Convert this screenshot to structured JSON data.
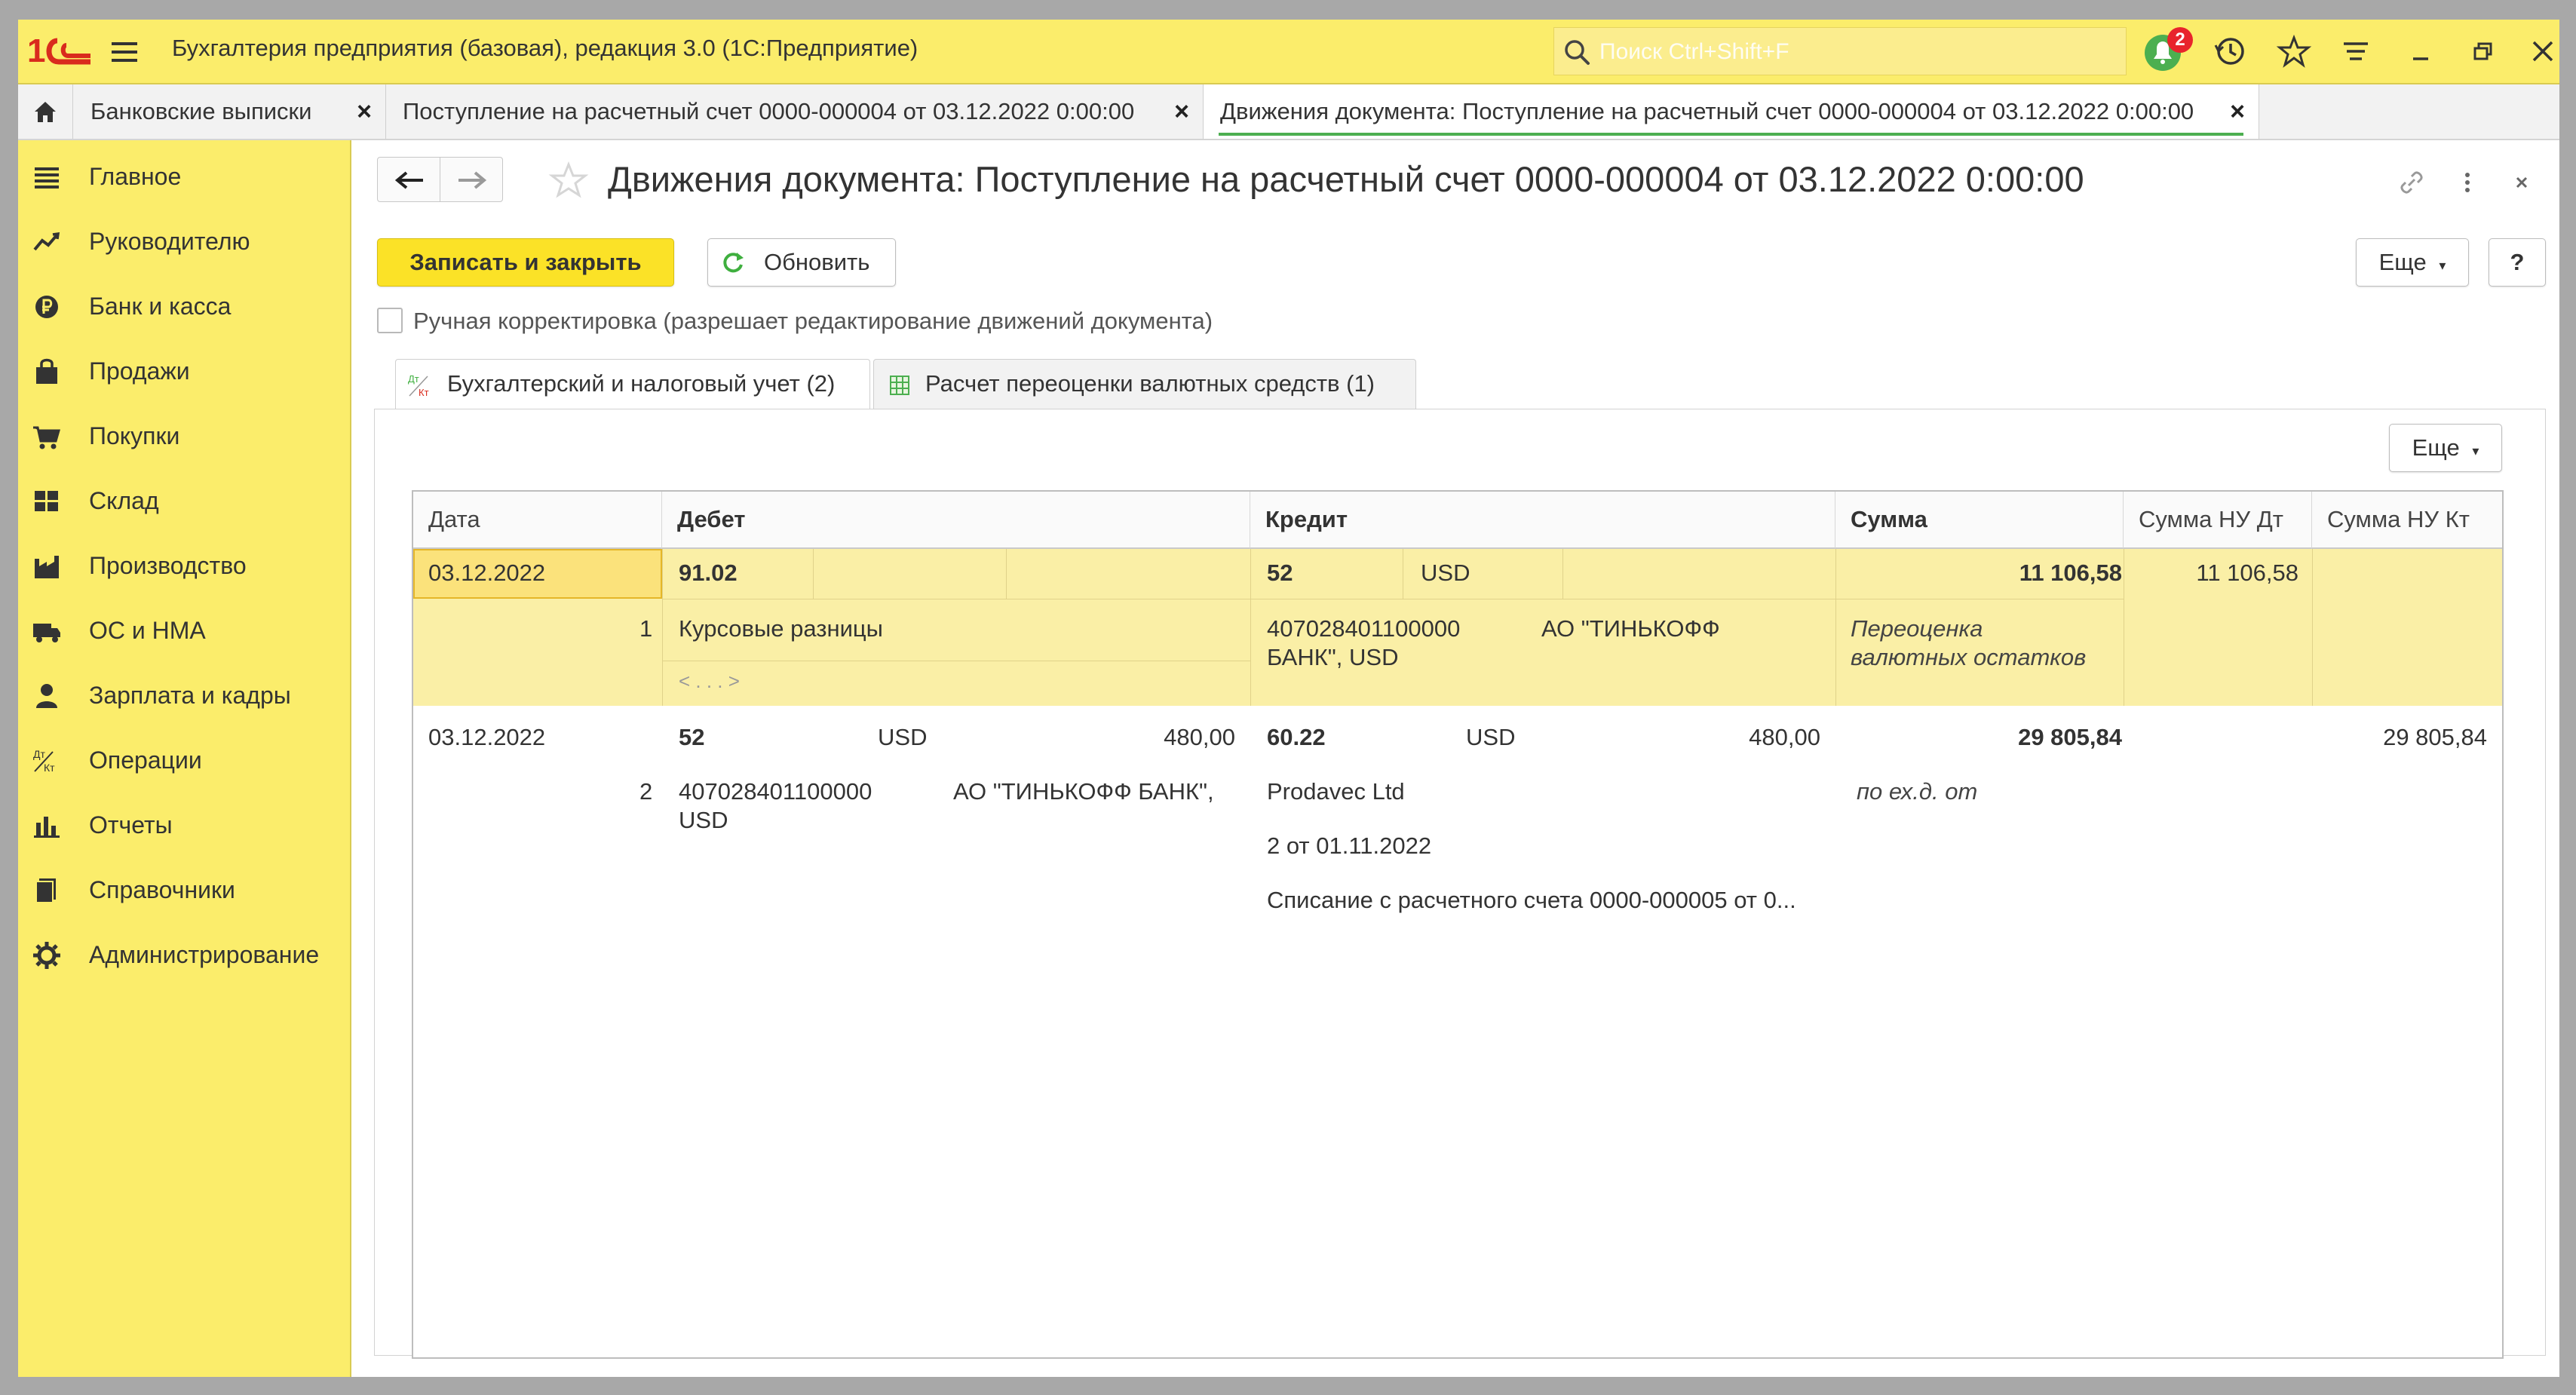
{
  "colors": {
    "accent_yellow": "#fbed6b",
    "save_button": "#fbe227",
    "selected_row": "#faefa6",
    "logo_red": "#d92b1d",
    "active_tab_underline": "#4caf50"
  },
  "app": {
    "title": "Бухгалтерия предприятия (базовая), редакция 3.0  (1С:Предприятие)"
  },
  "search": {
    "placeholder": "Поиск Ctrl+Shift+F"
  },
  "toolbar": {
    "notifications_count": "2"
  },
  "tabs": [
    {
      "label": "Банковские выписки",
      "close": "×"
    },
    {
      "label": "Поступление на расчетный счет 0000-000004 от 03.12.2022 0:00:00",
      "close": "×"
    },
    {
      "label": "Движения документа: Поступление на расчетный счет 0000-000004 от 03.12.2022 0:00:00",
      "close": "×"
    }
  ],
  "sidebar": {
    "items": [
      {
        "label": "Главное",
        "icon": "menu-icon"
      },
      {
        "label": "Руководителю",
        "icon": "trend-icon"
      },
      {
        "label": "Банк и касса",
        "icon": "ruble-coin-icon"
      },
      {
        "label": "Продажи",
        "icon": "shopping-bag-icon"
      },
      {
        "label": "Покупки",
        "icon": "cart-icon"
      },
      {
        "label": "Склад",
        "icon": "warehouse-icon"
      },
      {
        "label": "Производство",
        "icon": "factory-icon"
      },
      {
        "label": "ОС и НМА",
        "icon": "truck-icon"
      },
      {
        "label": "Зарплата и кадры",
        "icon": "person-icon"
      },
      {
        "label": "Операции",
        "icon": "dt-kt-icon"
      },
      {
        "label": "Отчеты",
        "icon": "bar-chart-icon"
      },
      {
        "label": "Справочники",
        "icon": "books-icon"
      },
      {
        "label": "Администрирование",
        "icon": "gear-icon"
      }
    ]
  },
  "form": {
    "title": "Движения документа: Поступление на расчетный счет 0000-000004 от 03.12.2022 0:00:00",
    "save_close_label": "Записать и закрыть",
    "refresh_label": "Обновить",
    "more_label": "Еще",
    "help_label": "?",
    "manual_correction_label": "Ручная корректировка (разрешает редактирование движений документа)",
    "inner_tabs": [
      {
        "label": "Бухгалтерский и налоговый учет (2)",
        "icon": "dt-kt-icon"
      },
      {
        "label": "Расчет переоценки валютных средств (1)",
        "icon": "table-icon"
      }
    ],
    "panel_more_label": "Еще"
  },
  "grid": {
    "columns": [
      "Дата",
      "Дебет",
      "Кредит",
      "Сумма",
      "Сумма НУ Дт",
      "Сумма НУ Кт"
    ],
    "rows": [
      {
        "date": "03.12.2022",
        "number": "1",
        "debit_account": "91.02",
        "debit_subconto": "Курсовые разницы",
        "debit_more": "< . . . >",
        "credit_account": "52",
        "credit_currency": "USD",
        "credit_subconto_1": "407028401100000",
        "credit_subconto_1b": "БАНК\", USD",
        "credit_subconto_2": "АО \"ТИНЬКОФФ",
        "amount": "11 106,58",
        "content_1": "Переоценка",
        "content_2": "валютных остатков",
        "amount_nu_dt": "11 106,58",
        "amount_nu_kt": ""
      },
      {
        "date": "03.12.2022",
        "number": "2",
        "debit_account": "52",
        "debit_currency": "USD",
        "debit_currency_amount": "480,00",
        "debit_subconto_1": "407028401100000",
        "debit_subconto_1b": "USD",
        "debit_subconto_2": "АО \"ТИНЬКОФФ БАНК\",",
        "credit_account": "60.22",
        "credit_currency": "USD",
        "credit_currency_amount": "480,00",
        "credit_subconto_1": "Prodavec Ltd",
        "credit_subconto_2": "2 от 01.11.2022",
        "credit_subconto_3": "Списание с расчетного счета 0000-000005 от 0...",
        "amount": "29 805,84",
        "content_1": "по ех.д.  от",
        "amount_nu_dt": "",
        "amount_nu_kt": "29 805,84"
      }
    ]
  }
}
